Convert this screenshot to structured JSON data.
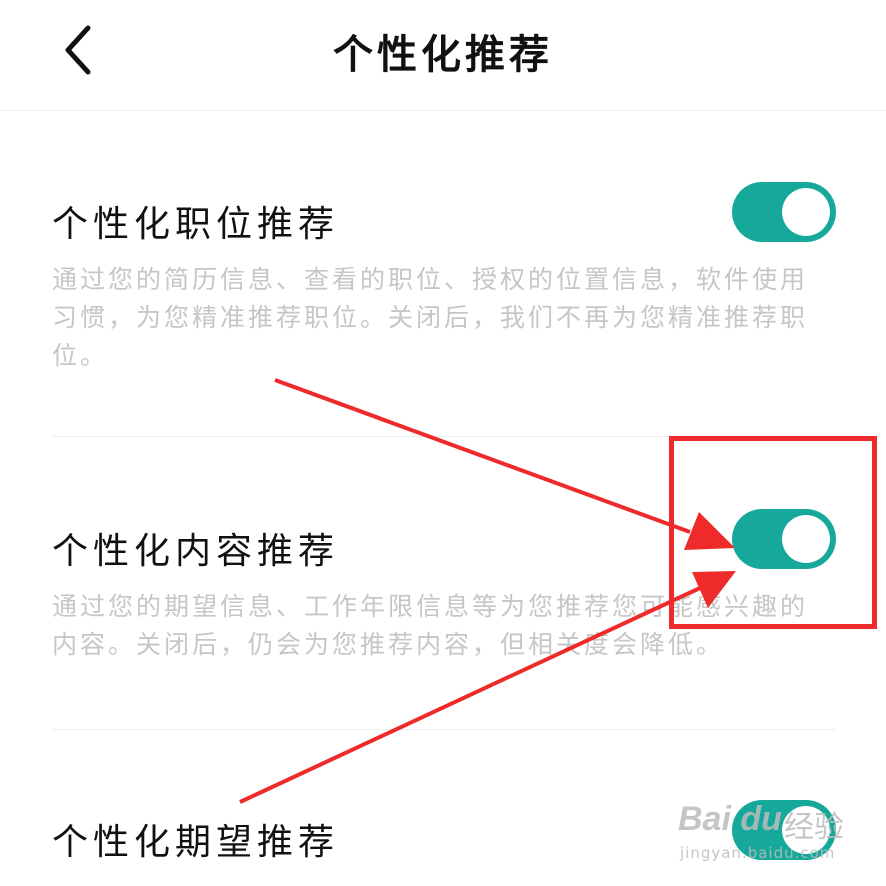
{
  "header": {
    "title": "个性化推荐"
  },
  "sections": [
    {
      "title": "个性化职位推荐",
      "description": "通过您的简历信息、查看的职位、授权的位置信息，软件使用习惯，为您精准推荐职位。关闭后，我们不再为您精准推荐职位。",
      "enabled": true
    },
    {
      "title": "个性化内容推荐",
      "description": "通过您的期望信息、工作年限信息等为您推荐您可能感兴趣的内容。关闭后，仍会为您推荐内容，但相关度会降低。",
      "enabled": true
    },
    {
      "title": "个性化期望推荐",
      "enabled": true
    }
  ],
  "watermark": {
    "brand": "Bai du",
    "brand_cn": "经验",
    "url": "jingyan.baidu.com"
  },
  "colors": {
    "toggle_on": "#16a99b",
    "annotation": "#ee2a2a",
    "description_text": "#c6c6c6"
  }
}
